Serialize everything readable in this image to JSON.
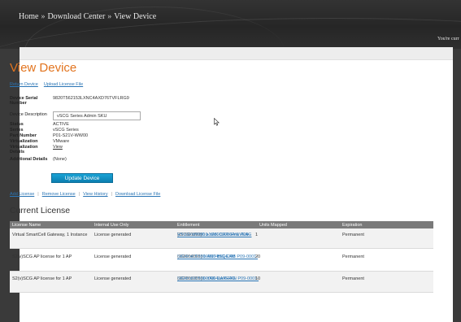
{
  "breadcrumb": {
    "home": "Home",
    "download_center": "Download Center",
    "current": "View Device",
    "separator": "»"
  },
  "header": {
    "welcome_text": "You're curr"
  },
  "page": {
    "title": "View Device"
  },
  "top_links": {
    "return": "Return Device",
    "upload": "Upload License File"
  },
  "device": {
    "serial_label": "Device Serial Number",
    "serial_value": "9820T562153LXNC4AXD76TVFLRG9",
    "description_label": "Device Description",
    "description_value": "vSCG Series Admin SKU",
    "status_label": "Status",
    "status_value": "ACTIVE",
    "series_label": "Series",
    "series_value": "vSCG Series",
    "part_label": "Part Number",
    "part_value": "P01-S21V-WW00",
    "virtualization_label": "Virtualization",
    "virtualization_value": "VMware",
    "virt_details_label": "Virtualization Details",
    "virt_details_link": "View",
    "additional_label": "Additional Details",
    "additional_value": "(None)"
  },
  "update_button": "Update Device",
  "actions": {
    "add": "Add License",
    "remove": "Remove License",
    "history": "View History",
    "download": "Download License File",
    "pipe": "|"
  },
  "license_section": {
    "title": "Current License"
  },
  "table": {
    "headers": {
      "name": "License Name",
      "internal": "Internal Use Only",
      "entitlement": "Entitlement",
      "units": "Units Mapped",
      "expiration": "Expiration"
    },
    "rows": [
      {
        "name": "Virtual SmartCell Gateway, 1 Instance",
        "internal": "License generated",
        "ent_line1": "RTU-00390910-YAK-CAR-EYE P09-",
        "ent_line2": "VSCG-WW00 a1D50000004eaVEAG",
        "ent_num": "(117331311)",
        "units": "1",
        "expiration": "Permanent"
      },
      {
        "name": "S2(v)SCG AP license for 1 AP",
        "internal": "License generated",
        "ent_line1": "LIC-00400251-ANT-BIG-CAB P09-0001-",
        "ent_line2": "SG00 a1D50000004tSQEAM",
        "ent_num": "(118259541)",
        "units": "20",
        "expiration": "Permanent"
      },
      {
        "name": "S2(v)SCG AP license for 1 AP",
        "internal": "License generated",
        "ent_line1": "LIC-00390911-YAK-CAR-FAN P09-0001-",
        "ent_line2": "SG00 a1D50000004eaYEAG",
        "ent_num": "(117331351)",
        "units": "10",
        "expiration": "Permanent"
      }
    ]
  },
  "colors": {
    "title_orange": "#e2741f",
    "link_blue": "#2a75b5",
    "button_blue": "#1aa3d6",
    "header_gray": "#7a7a7a"
  }
}
